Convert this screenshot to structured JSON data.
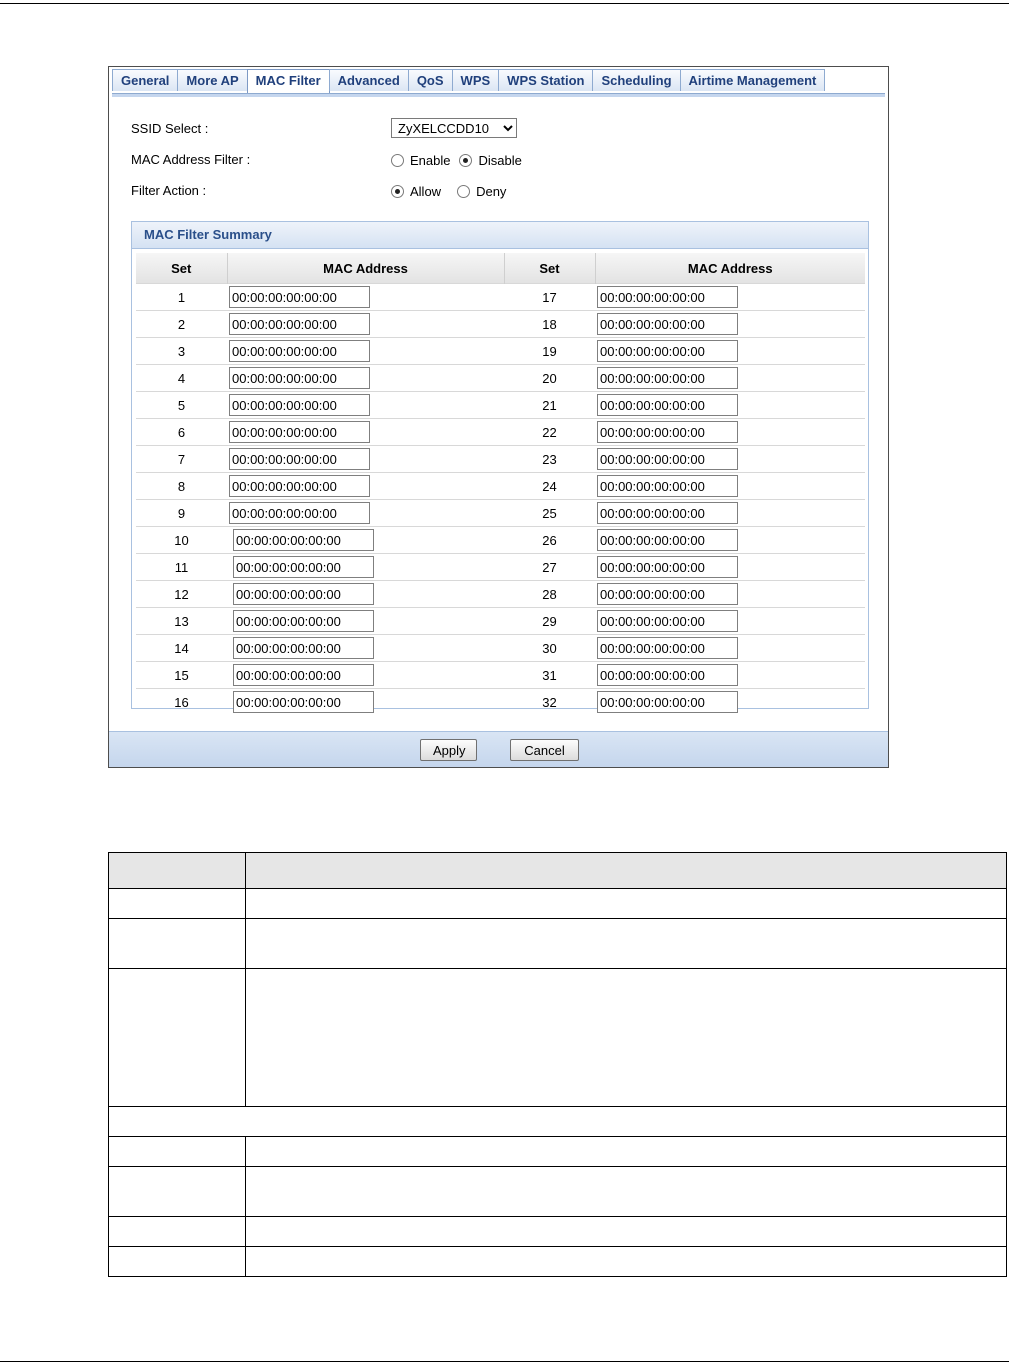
{
  "tabs": [
    "General",
    "More AP",
    "MAC Filter",
    "Advanced",
    "QoS",
    "WPS",
    "WPS Station",
    "Scheduling",
    "Airtime Management"
  ],
  "active_tab": "MAC Filter",
  "form": {
    "ssid_label": "SSID Select :",
    "ssid_value": "ZyXELCCDD10",
    "mac_filter_label": "MAC Address Filter :",
    "enable_label": "Enable",
    "disable_label": "Disable",
    "mac_filter_state": "Disable",
    "filter_action_label": "Filter Action :",
    "allow_label": "Allow",
    "deny_label": "Deny",
    "filter_action_state": "Allow"
  },
  "summary": {
    "title": "MAC Filter Summary",
    "col_set": "Set",
    "col_mac": "MAC Address",
    "rows": [
      {
        "left_set": "1",
        "left_mac": "00:00:00:00:00:00",
        "right_set": "17",
        "right_mac": "00:00:00:00:00:00"
      },
      {
        "left_set": "2",
        "left_mac": "00:00:00:00:00:00",
        "right_set": "18",
        "right_mac": "00:00:00:00:00:00"
      },
      {
        "left_set": "3",
        "left_mac": "00:00:00:00:00:00",
        "right_set": "19",
        "right_mac": "00:00:00:00:00:00"
      },
      {
        "left_set": "4",
        "left_mac": "00:00:00:00:00:00",
        "right_set": "20",
        "right_mac": "00:00:00:00:00:00"
      },
      {
        "left_set": "5",
        "left_mac": "00:00:00:00:00:00",
        "right_set": "21",
        "right_mac": "00:00:00:00:00:00"
      },
      {
        "left_set": "6",
        "left_mac": "00:00:00:00:00:00",
        "right_set": "22",
        "right_mac": "00:00:00:00:00:00"
      },
      {
        "left_set": "7",
        "left_mac": "00:00:00:00:00:00",
        "right_set": "23",
        "right_mac": "00:00:00:00:00:00"
      },
      {
        "left_set": "8",
        "left_mac": "00:00:00:00:00:00",
        "right_set": "24",
        "right_mac": "00:00:00:00:00:00"
      },
      {
        "left_set": "9",
        "left_mac": "00:00:00:00:00:00",
        "right_set": "25",
        "right_mac": "00:00:00:00:00:00"
      },
      {
        "left_set": "10",
        "left_mac": "00:00:00:00:00:00",
        "right_set": "26",
        "right_mac": "00:00:00:00:00:00"
      },
      {
        "left_set": "11",
        "left_mac": "00:00:00:00:00:00",
        "right_set": "27",
        "right_mac": "00:00:00:00:00:00"
      },
      {
        "left_set": "12",
        "left_mac": "00:00:00:00:00:00",
        "right_set": "28",
        "right_mac": "00:00:00:00:00:00"
      },
      {
        "left_set": "13",
        "left_mac": "00:00:00:00:00:00",
        "right_set": "29",
        "right_mac": "00:00:00:00:00:00"
      },
      {
        "left_set": "14",
        "left_mac": "00:00:00:00:00:00",
        "right_set": "30",
        "right_mac": "00:00:00:00:00:00"
      },
      {
        "left_set": "15",
        "left_mac": "00:00:00:00:00:00",
        "right_set": "31",
        "right_mac": "00:00:00:00:00:00"
      },
      {
        "left_set": "16",
        "left_mac": "00:00:00:00:00:00",
        "right_set": "32",
        "right_mac": "00:00:00:00:00:00"
      }
    ]
  },
  "buttons": {
    "apply": "Apply",
    "cancel": "Cancel"
  },
  "colors": {
    "tab_text": "#20407c",
    "panel_blue": "#c5d6ed",
    "doc_header_bg": "#e6e6e6"
  }
}
